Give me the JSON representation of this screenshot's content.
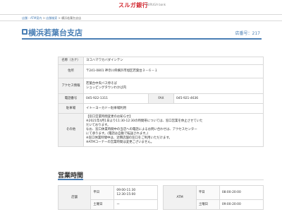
{
  "header": {
    "logo": "スルガ銀行",
    "logo_sub": "SURUGA bank"
  },
  "breadcrumb": {
    "part1": "店舗・ATM案内",
    "sep1": " > ",
    "part2": "店舗検索",
    "sep2": " > ",
    "part3": "横浜若葉台支店"
  },
  "branch": {
    "name": "横浜若葉台支店",
    "store_no_label": "店番号：",
    "store_no": "217"
  },
  "info": {
    "kana_label": "名称（カナ）",
    "kana_value": "ヨコハマワカバダイシテン",
    "address_label": "住所",
    "address_value": "〒241-0801 神奈川県横浜市旭区若葉台３－６－１",
    "access_label": "アクセス情報",
    "access_line1": "若葉台中央バス停そば",
    "access_line2": "ショッピングタウンわかば内",
    "phone_label": "電話番号",
    "phone_value": "045-922-1311",
    "fax_label": "FAX",
    "fax_value": "045-921-4636",
    "parking_label": "駐車場",
    "parking_value": "イトーヨーカドー駐車場利用",
    "other_label": "その他",
    "notice_line1": "【窓口営業時間変更のお知らせ】",
    "notice_line2": "※2021年4月1日より11:30-12:30の時間帯については、窓口営業を休止させていた",
    "notice_line3": "だいております。",
    "notice_line4": "なお、窓口休業時間中の当店への電話によるお問い合わせは、アクセスセンター",
    "notice_line5": "にて承ります。(電話は自動で転送されます。)",
    "notice_line6": "※窓口休業時間中は、近隣店舗の窓口をご利用いただけます。",
    "notice_line7": "※ATMコーナーの営業時間は変更ございません。"
  },
  "hours": {
    "title": "営業時間",
    "store_label": "店舗",
    "store_rows": [
      {
        "day": "平日",
        "time1": "09:00-11:30",
        "time2": "12:30-15:00"
      },
      {
        "day": "土曜日",
        "time1": "ー",
        "time2": ""
      }
    ],
    "atm_label": "ATM",
    "atm_rows": [
      {
        "day": "平日",
        "time": "08:00-20:00"
      },
      {
        "day": "土曜日",
        "time": "09:00-20:00"
      }
    ]
  }
}
